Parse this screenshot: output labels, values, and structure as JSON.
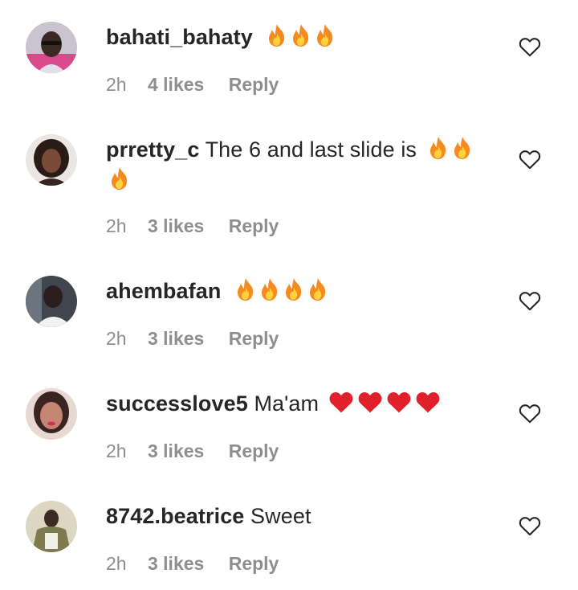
{
  "comments": [
    {
      "username": "bahati_bahaty",
      "text": "",
      "emojis": [
        "fire",
        "fire",
        "fire"
      ],
      "time": "2h",
      "likes": "4 likes",
      "reply": "Reply",
      "avatar_color": "#3b2a24"
    },
    {
      "username": "prretty_c",
      "text": "The 6 and last slide is",
      "emojis": [
        "fire",
        "fire",
        "fire"
      ],
      "time": "2h",
      "likes": "3 likes",
      "reply": "Reply",
      "avatar_color": "#4a2b22"
    },
    {
      "username": "ahembafan",
      "text": "",
      "emojis": [
        "fire",
        "fire",
        "fire",
        "fire"
      ],
      "time": "2h",
      "likes": "3 likes",
      "reply": "Reply",
      "avatar_color": "#5b6470"
    },
    {
      "username": "successlove5",
      "text": "Ma'am",
      "emojis": [
        "red-heart",
        "red-heart",
        "red-heart",
        "red-heart"
      ],
      "time": "2h",
      "likes": "3 likes",
      "reply": "Reply",
      "avatar_color": "#d9a08c"
    },
    {
      "username": "8742.beatrice",
      "text": "Sweet",
      "emojis": [],
      "time": "2h",
      "likes": "3 likes",
      "reply": "Reply",
      "avatar_color": "#c8c2ae"
    }
  ],
  "colors": {
    "text": "#262626",
    "meta": "#8e8e8e",
    "fire": "#f58a1f",
    "heart": "#e0202b"
  }
}
